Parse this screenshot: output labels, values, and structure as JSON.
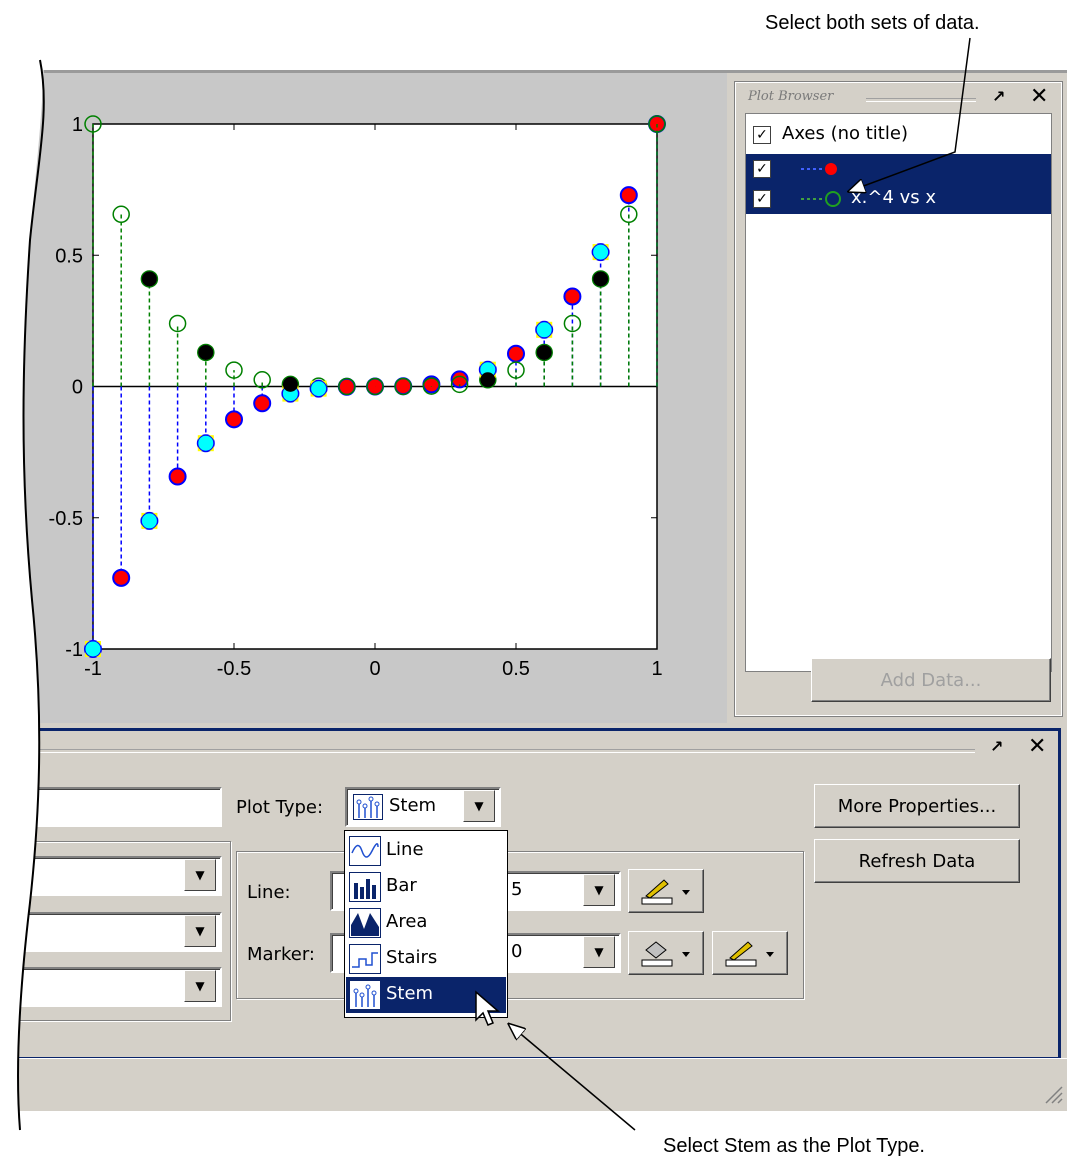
{
  "annotations": {
    "top": "Select both sets of data.",
    "bottom": "Select Stem as the Plot Type."
  },
  "plot_browser": {
    "title": "Plot Browser",
    "items": [
      {
        "label": "Axes (no title)",
        "checked": true,
        "selected": false
      },
      {
        "label": "",
        "checked": true,
        "selected": true
      },
      {
        "label": "x.^4 vs x",
        "checked": true,
        "selected": true
      }
    ],
    "add_data_label": "Add Data..."
  },
  "property_editor": {
    "plot_type_label": "Plot Type:",
    "plot_type_value": "Stem",
    "more_properties_label": "More Properties...",
    "refresh_data_label": "Refresh Data",
    "line_label": "Line:",
    "marker_label": "Marker:",
    "line_width_value": "5",
    "marker_size_value": "0",
    "plot_type_options": [
      {
        "label": "Line",
        "icon": "line-plot-icon"
      },
      {
        "label": "Bar",
        "icon": "bar-plot-icon"
      },
      {
        "label": "Area",
        "icon": "area-plot-icon"
      },
      {
        "label": "Stairs",
        "icon": "stairs-plot-icon"
      },
      {
        "label": "Stem",
        "icon": "stem-plot-icon",
        "selected": true
      }
    ]
  },
  "chart_data": {
    "type": "scatter",
    "xlim": [
      -1,
      1
    ],
    "ylim": [
      -1,
      1
    ],
    "xticks": [
      "-1",
      "-0.5",
      "0",
      "0.5",
      "1"
    ],
    "yticks": [
      "-1",
      "-0.5",
      "0",
      "0.5",
      "1"
    ],
    "grid": false,
    "series": [
      {
        "kind": "stem",
        "color": "#0000ff",
        "marker_color": "#ff0000",
        "x": [
          -1,
          -0.9,
          -0.8,
          -0.7,
          -0.6,
          -0.5,
          -0.4,
          -0.3,
          -0.2,
          -0.1,
          0,
          0.1,
          0.2,
          0.3,
          0.4,
          0.5,
          0.6,
          0.7,
          0.8,
          0.9,
          1
        ],
        "y": [
          -1,
          -0.729,
          -0.512,
          -0.343,
          -0.216,
          -0.125,
          -0.064,
          -0.027,
          -0.008,
          -0.001,
          0,
          0.001,
          0.008,
          0.027,
          0.064,
          0.125,
          0.216,
          0.343,
          0.512,
          0.729,
          1
        ]
      },
      {
        "kind": "stem",
        "color": "#008000",
        "marker": "open-circle",
        "x": [
          -1,
          -0.9,
          -0.8,
          -0.7,
          -0.6,
          -0.5,
          -0.4,
          -0.3,
          -0.2,
          -0.1,
          0,
          0.1,
          0.2,
          0.3,
          0.4,
          0.5,
          0.6,
          0.7,
          0.8,
          0.9,
          1
        ],
        "y": [
          1,
          0.6561,
          0.4096,
          0.2401,
          0.1296,
          0.0625,
          0.0256,
          0.0081,
          0.0016,
          0.0001,
          0,
          0.0001,
          0.0016,
          0.0081,
          0.0256,
          0.0625,
          0.1296,
          0.2401,
          0.4096,
          0.6561,
          1
        ]
      },
      {
        "kind": "markers",
        "color": "#00ffff",
        "x": [
          -1,
          -0.8,
          -0.6,
          -0.3,
          -0.2,
          0.4,
          0.6,
          0.8
        ],
        "y": [
          -1,
          -0.512,
          -0.216,
          -0.027,
          -0.008,
          0.064,
          0.216,
          0.512
        ]
      },
      {
        "kind": "markers",
        "color": "#000000",
        "x": [
          -0.8,
          -0.6,
          -0.3,
          0.4,
          0.6,
          0.8
        ],
        "y": [
          0.4096,
          0.1296,
          0.0081,
          0.0256,
          0.1296,
          0.4096
        ]
      }
    ]
  },
  "colors": {
    "selection": "#0a246a",
    "figure_bg": "#c8c8c8",
    "panel_bg": "#d4d0c8"
  }
}
